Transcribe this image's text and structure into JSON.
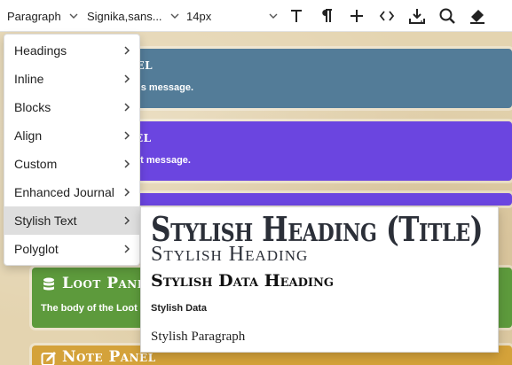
{
  "toolbar": {
    "block_format": "Paragraph",
    "font_family": "Signika,sans...",
    "font_size": "14px",
    "icons": [
      "text-icon",
      "paragraph-icon",
      "plus-icon",
      "code-icon",
      "save-icon",
      "search-icon",
      "eraser-icon"
    ]
  },
  "panels": [
    {
      "title": "nel",
      "body": "us message.",
      "color": "#537c98"
    },
    {
      "title": "el",
      "body": "ct message.",
      "color": "#6b45e0"
    },
    {
      "title": "Loot Panel",
      "body": "The body of the Loot",
      "color": "#5d9a3c"
    },
    {
      "title": "Note Panel",
      "body": "",
      "color": "#d4a23a"
    }
  ],
  "menu": {
    "items": [
      {
        "label": "Headings"
      },
      {
        "label": "Inline"
      },
      {
        "label": "Blocks"
      },
      {
        "label": "Align"
      },
      {
        "label": "Custom"
      },
      {
        "label": "Enhanced Journal"
      },
      {
        "label": "Stylish Text"
      },
      {
        "label": "Polyglot"
      }
    ],
    "active_index": 6
  },
  "submenu": {
    "items": [
      {
        "label": "Stylish Heading (Title)"
      },
      {
        "label": "Stylish Heading"
      },
      {
        "label": "Stylish Data Heading"
      },
      {
        "label": "Stylish Data"
      },
      {
        "label": "Stylish Paragraph"
      }
    ]
  }
}
